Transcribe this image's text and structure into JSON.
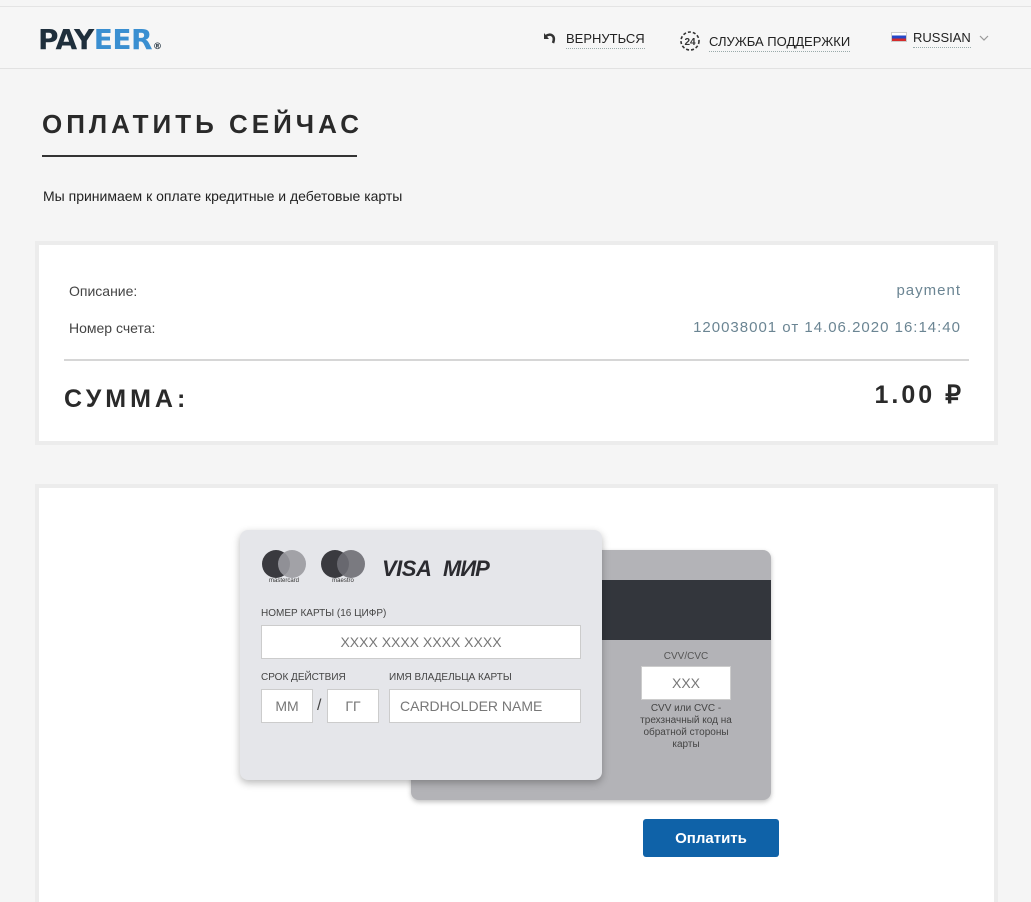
{
  "header": {
    "logo_part1": "PAY",
    "logo_part2": "EER",
    "logo_mark": "®",
    "back_label": "ВЕРНУТЬСЯ",
    "support_label": "СЛУЖБА ПОДДЕРЖКИ",
    "support_icon_text": "24",
    "language_label": "RUSSIAN",
    "icons": [
      "back-arrow-icon",
      "support-24-icon",
      "russian-flag-icon",
      "chevron-down-icon"
    ]
  },
  "page": {
    "title": "ОПЛАТИТЬ СЕЙЧАС",
    "intro": "Мы принимаем к оплате кредитные и дебетовые карты"
  },
  "summary": {
    "description_label": "Описание:",
    "description_value": "payment",
    "account_label": "Номер счета:",
    "account_value": "120038001 от 14.06.2020 16:14:40",
    "amount_label": "СУММА:",
    "amount_value": "1.00 ₽"
  },
  "card": {
    "brands": {
      "mastercard": "mastercard",
      "maestro": "maestro",
      "visa": "VISA",
      "mir": "МИР"
    },
    "number_label": "НОМЕР КАРТЫ (16 ЦИФР)",
    "number_placeholder": "XXXX XXXX XXXX XXXX",
    "expiry_label": "СРОК ДЕЙСТВИЯ",
    "month_placeholder": "ММ",
    "separator": "/",
    "year_placeholder": "ГГ",
    "holder_label": "ИМЯ ВЛАДЕЛЬЦА КАРТЫ",
    "holder_placeholder": "CARDHOLDER NAME",
    "cvv_label": "CVV/CVC",
    "cvv_placeholder": "XXX",
    "cvv_note": "CVV или CVC - трехзначный код на обратной стороны карты"
  },
  "actions": {
    "pay_label": "Оплатить"
  },
  "colors": {
    "brand_dark": "#1f2f3c",
    "brand_blue": "#3a8fd1",
    "button": "#0f62a8",
    "card_front": "#e5e6ea",
    "card_back": "#b3b3b7",
    "magnetic_stripe": "#33363c"
  }
}
